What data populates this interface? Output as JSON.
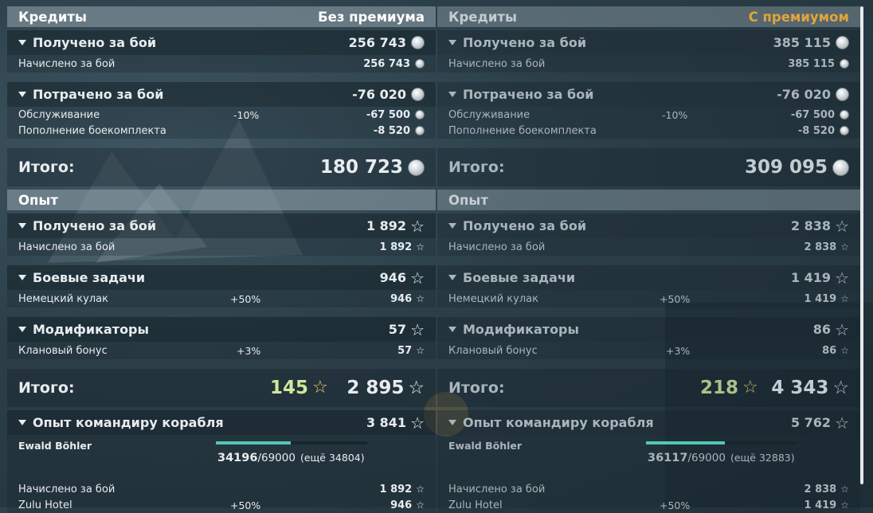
{
  "credits": {
    "left": {
      "title": "Кредиты",
      "mode": "Без премиума",
      "earned": {
        "label": "Получено за бой",
        "value": "256 743",
        "rows": [
          {
            "label": "Начислено за бой",
            "pct": "",
            "value": "256 743"
          }
        ]
      },
      "spent": {
        "label": "Потрачено за бой",
        "value": "-76 020",
        "rows": [
          {
            "label": "Обслуживание",
            "pct": "-10%",
            "value": "-67 500"
          },
          {
            "label": "Пополнение боекомплекта",
            "pct": "",
            "value": "-8 520"
          }
        ]
      },
      "total": {
        "label": "Итого:",
        "value": "180 723"
      }
    },
    "right": {
      "title": "Кредиты",
      "mode": "С премиумом",
      "earned": {
        "label": "Получено за бой",
        "value": "385 115",
        "rows": [
          {
            "label": "Начислено за бой",
            "pct": "",
            "value": "385 115"
          }
        ]
      },
      "spent": {
        "label": "Потрачено за бой",
        "value": "-76 020",
        "rows": [
          {
            "label": "Обслуживание",
            "pct": "-10%",
            "value": "-67 500"
          },
          {
            "label": "Пополнение боекомплекта",
            "pct": "",
            "value": "-8 520"
          }
        ]
      },
      "total": {
        "label": "Итого:",
        "value": "309 095"
      }
    }
  },
  "experience": {
    "left": {
      "title": "Опыт",
      "earned": {
        "label": "Получено за бой",
        "value": "1 892",
        "rows": [
          {
            "label": "Начислено за бой",
            "pct": "",
            "value": "1 892"
          }
        ]
      },
      "missions": {
        "label": "Боевые задачи",
        "value": "946",
        "rows": [
          {
            "label": "Немецкий кулак",
            "pct": "+50%",
            "value": "946"
          }
        ]
      },
      "modifiers": {
        "label": "Модификаторы",
        "value": "57",
        "rows": [
          {
            "label": "Клановый бонус",
            "pct": "+3%",
            "value": "57"
          }
        ]
      },
      "total": {
        "label": "Итого:",
        "free_xp": "145",
        "value": "2 895"
      },
      "commander": {
        "label": "Опыт командиру корабля",
        "value": "3 841",
        "name": "Ewald Böhler",
        "xp": "34196",
        "xp_max": "/69000",
        "remaining": "(ещё 34804)",
        "progress": 0.4956,
        "rows": [
          {
            "label": "Начислено за бой",
            "pct": "",
            "value": "1 892"
          },
          {
            "label": "Zulu Hotel",
            "pct": "+50%",
            "value": "946"
          }
        ]
      }
    },
    "right": {
      "title": "Опыт",
      "earned": {
        "label": "Получено за бой",
        "value": "2 838",
        "rows": [
          {
            "label": "Начислено за бой",
            "pct": "",
            "value": "2 838"
          }
        ]
      },
      "missions": {
        "label": "Боевые задачи",
        "value": "1 419",
        "rows": [
          {
            "label": "Немецкий кулак",
            "pct": "+50%",
            "value": "1 419"
          }
        ]
      },
      "modifiers": {
        "label": "Модификаторы",
        "value": "86",
        "rows": [
          {
            "label": "Клановый бонус",
            "pct": "+3%",
            "value": "86"
          }
        ]
      },
      "total": {
        "label": "Итого:",
        "free_xp": "218",
        "value": "4 343"
      },
      "commander": {
        "label": "Опыт командиру корабля",
        "value": "5 762",
        "name": "Ewald Böhler",
        "xp": "36117",
        "xp_max": "/69000",
        "remaining": "(ещё 32883)",
        "progress": 0.5234,
        "rows": [
          {
            "label": "Начислено за бой",
            "pct": "",
            "value": "2 838"
          },
          {
            "label": "Zulu Hotel",
            "pct": "+50%",
            "value": "1 419"
          }
        ]
      }
    }
  },
  "colors": {
    "premium": "#e1a43b",
    "free_xp": "#cfe89a",
    "progress": "#56c4b8"
  }
}
